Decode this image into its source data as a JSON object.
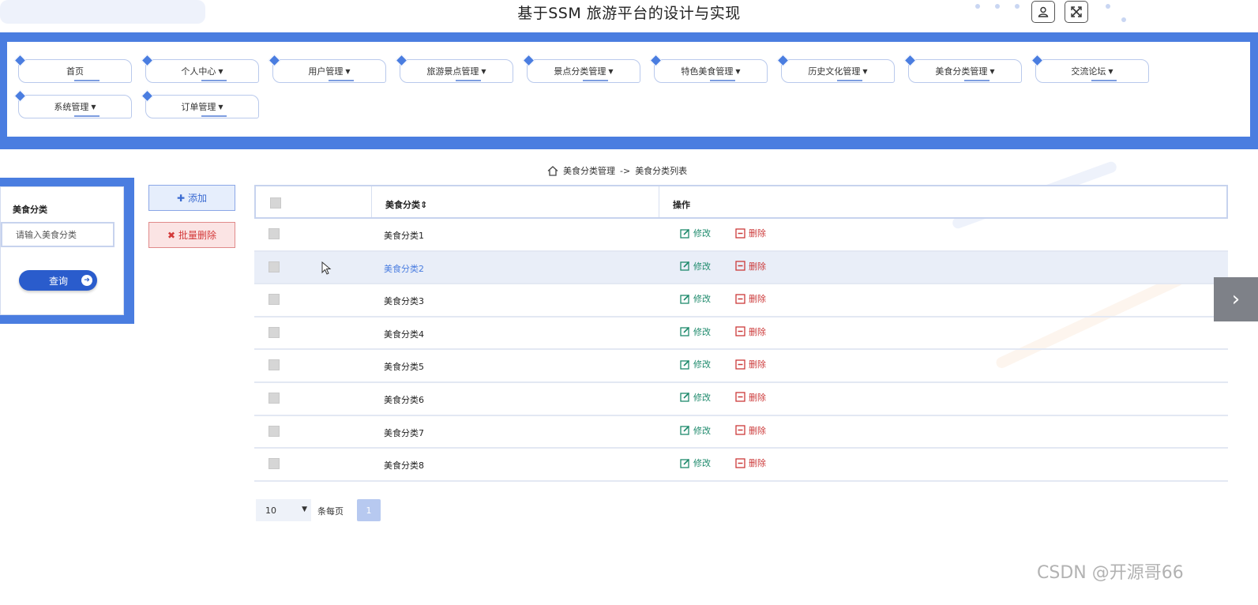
{
  "app_title": "基于SSM 旅游平台的设计与实现",
  "nav": {
    "row1": [
      {
        "label": "首页",
        "dropdown": false
      },
      {
        "label": "个人中心",
        "dropdown": true
      },
      {
        "label": "用户管理",
        "dropdown": true
      },
      {
        "label": "旅游景点管理",
        "dropdown": true
      },
      {
        "label": "景点分类管理",
        "dropdown": true
      },
      {
        "label": "特色美食管理",
        "dropdown": true
      },
      {
        "label": "历史文化管理",
        "dropdown": true
      },
      {
        "label": "美食分类管理",
        "dropdown": true
      },
      {
        "label": "交流论坛",
        "dropdown": true
      }
    ],
    "row2": [
      {
        "label": "系统管理",
        "dropdown": true
      },
      {
        "label": "订单管理",
        "dropdown": true
      }
    ]
  },
  "breadcrumb": {
    "section": "美食分类管理",
    "separator": "->",
    "page": "美食分类列表"
  },
  "search": {
    "label": "美食分类",
    "placeholder": "请输入美食分类",
    "button": "查询"
  },
  "actions": {
    "add": "添加",
    "batch_delete": "批量删除"
  },
  "table": {
    "headers": {
      "name": "美食分类",
      "sort_glyph": "⇕",
      "operation": "操作"
    },
    "rows": [
      {
        "name": "美食分类1"
      },
      {
        "name": "美食分类2"
      },
      {
        "name": "美食分类3"
      },
      {
        "name": "美食分类4"
      },
      {
        "name": "美食分类5"
      },
      {
        "name": "美食分类6"
      },
      {
        "name": "美食分类7"
      },
      {
        "name": "美食分类8"
      }
    ],
    "edit_label": "修改",
    "delete_label": "删除"
  },
  "pagination": {
    "page_size": "10",
    "per_page_label": "条每页",
    "current_page": "1"
  },
  "watermark": "CSDN @开源哥66",
  "colors": {
    "primary": "#4a7de0",
    "edit": "#1e8a6c",
    "delete": "#cc3a3a"
  }
}
